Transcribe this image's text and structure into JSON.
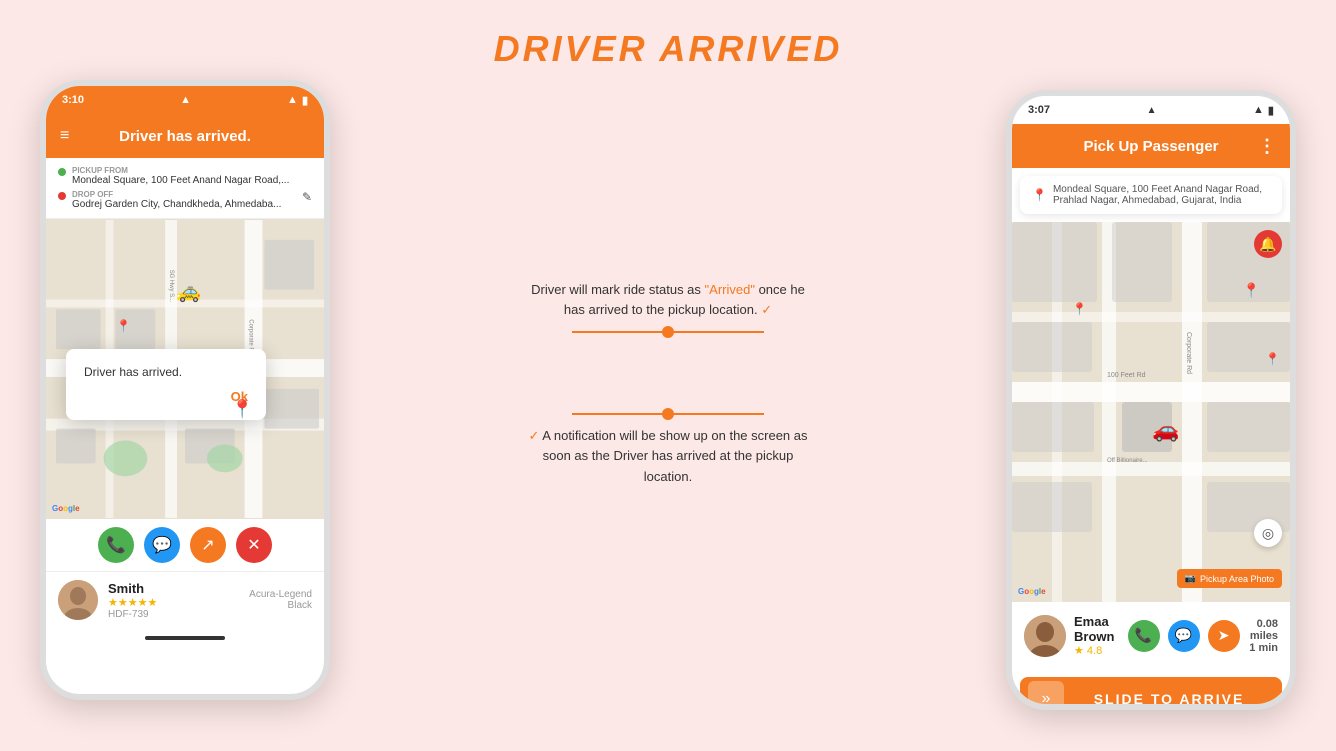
{
  "page": {
    "title": "DRIVER ARRIVED",
    "background": "#fce8e6"
  },
  "left_phone": {
    "status_bar": {
      "time": "3:10",
      "signal": "▲",
      "wifi": "◀",
      "battery": "🔋"
    },
    "header_title": "Driver has arrived.",
    "pickup_label": "PICKUP FROM",
    "pickup_address": "Mondeal Square, 100 Feet Anand Nagar Road,...",
    "dropoff_label": "DROP OFF",
    "dropoff_address": "Godrej Garden City, Chandkheda, Ahmedaba...",
    "alert_message": "Driver has arrived.",
    "alert_ok": "Ok",
    "driver_name": "Smith",
    "driver_id": "HDF-739",
    "driver_car": "Acura-Legend",
    "driver_car_color": "Black",
    "driver_rating": "★★★★★",
    "google_text": "Google"
  },
  "right_phone": {
    "status_bar": {
      "time": "3:07",
      "signal": "▲",
      "wifi": "◀",
      "battery": "🔋"
    },
    "header_title": "Pick Up Passenger",
    "search_address": "Mondeal Square, 100 Feet Anand Nagar Road, Prahlad Nagar, Ahmedabad, Gujarat, India",
    "pickup_photo_btn": "Pickup Area Photo",
    "passenger_name": "Emaa Brown",
    "passenger_rating": "★ 4.8",
    "distance": "0.08 miles",
    "time_est": "1 min",
    "slide_text": "SLIDE TO ARRIVE",
    "google_text": "Google"
  },
  "annotations": [
    {
      "id": "ann1",
      "text_before": "Driver will mark ride status as ",
      "highlight": "\"Arrived\"",
      "text_after": " once he has arrived to the pickup location.",
      "has_checkmark": true
    },
    {
      "id": "ann2",
      "text": "A notification will be show up on the screen as soon as the Driver has arrived at the pickup location.",
      "has_checkmark": true
    }
  ],
  "icons": {
    "menu": "≡",
    "more": "⋮",
    "phone": "📞",
    "chat": "💬",
    "share": "↗",
    "close": "✕",
    "edit": "✎",
    "location": "📍",
    "camera": "📷",
    "crosshair": "◎",
    "chevron_right": "»",
    "navigate": "➤"
  }
}
